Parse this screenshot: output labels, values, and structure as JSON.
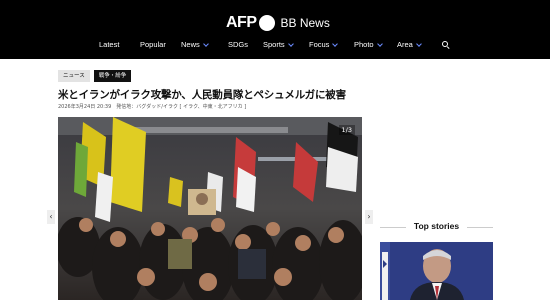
{
  "header": {
    "logo_afp": "AFP",
    "logo_bb": "BB News",
    "nav": [
      {
        "label": "Latest",
        "dropdown": false
      },
      {
        "label": "Popular",
        "dropdown": false
      },
      {
        "label": "News",
        "dropdown": true
      },
      {
        "label": "SDGs",
        "dropdown": false
      },
      {
        "label": "Sports",
        "dropdown": true
      },
      {
        "label": "Focus",
        "dropdown": true
      },
      {
        "label": "Photo",
        "dropdown": true
      },
      {
        "label": "Area",
        "dropdown": true
      }
    ],
    "search_icon": "search-icon"
  },
  "article": {
    "tags": [
      "ニュース",
      "戦争・紛争"
    ],
    "title": "米とイランがイラク攻撃か、人民動員隊とペシュメルガに被害",
    "meta": "2026年3月24日 20:39　発信地：バグダッド/イラク [ イラク、中東・北アフリカ ]",
    "photo_counter": "1/3",
    "prev_label": "‹",
    "next_label": "›"
  },
  "sidebar": {
    "top_stories_label": "Top stories"
  },
  "colors": {
    "header_bg": "#000000",
    "accent_chevron": "#6b8cff",
    "tag_dark": "#111111",
    "tag_light": "#e3e3e3"
  }
}
